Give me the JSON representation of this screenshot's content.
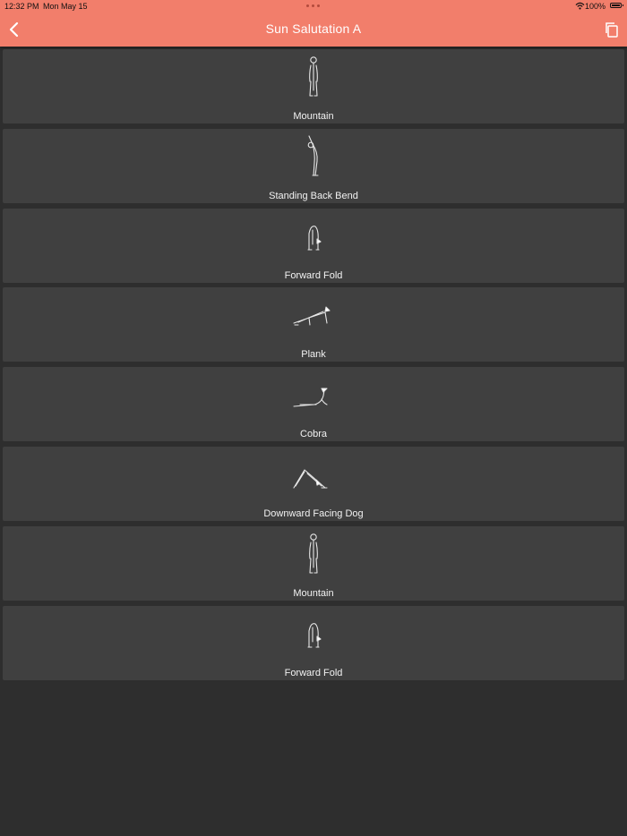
{
  "status_bar": {
    "time": "12:32 PM",
    "date": "Mon May 15",
    "battery": "100%"
  },
  "header": {
    "title": "Sun Salutation A"
  },
  "colors": {
    "accent": "#f27e6b",
    "background": "#2e2e2e",
    "card": "#404040"
  },
  "icons": {
    "back": "chevron-left-icon",
    "copy": "copy-icon",
    "wifi": "wifi-icon",
    "battery": "battery-icon"
  },
  "poses": [
    {
      "label": "Mountain",
      "icon": "mountain"
    },
    {
      "label": "Standing Back Bend",
      "icon": "backbend"
    },
    {
      "label": "Forward Fold",
      "icon": "fold"
    },
    {
      "label": "Plank",
      "icon": "plank"
    },
    {
      "label": "Cobra",
      "icon": "cobra"
    },
    {
      "label": "Downward Facing Dog",
      "icon": "dog"
    },
    {
      "label": "Mountain",
      "icon": "mountain"
    },
    {
      "label": "Forward Fold",
      "icon": "fold"
    }
  ]
}
